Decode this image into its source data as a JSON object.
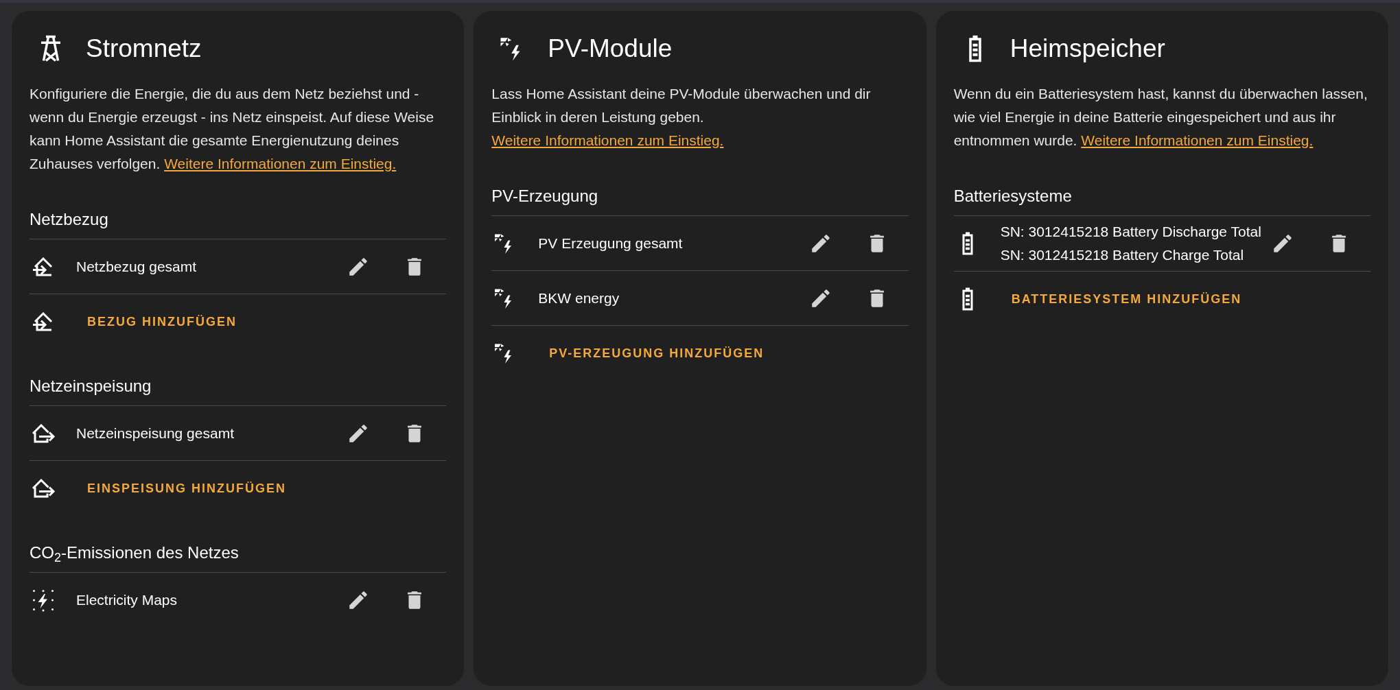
{
  "cards": [
    {
      "title": "Stromnetz",
      "description": "Konfiguriere die Energie, die du aus dem Netz beziehst und - wenn du Energie erzeugst - ins Netz einspeist. Auf diese Weise kann Home Assistant die gesamte Energienutzung deines Zuhauses verfolgen.",
      "link": "Weitere Informationen zum Einstieg.",
      "sections": [
        {
          "heading": "Netzbezug",
          "items": [
            {
              "lines": [
                "Netzbezug gesamt"
              ]
            }
          ],
          "add_label": "BEZUG HINZUFÜGEN"
        },
        {
          "heading": "Netzeinspeisung",
          "items": [
            {
              "lines": [
                "Netzeinspeisung gesamt"
              ]
            }
          ],
          "add_label": "EINSPEISUNG HINZUFÜGEN"
        },
        {
          "heading": "CO$_{2}$-Emissionen des Netzes",
          "items": [
            {
              "lines": [
                "Electricity Maps"
              ]
            }
          ]
        }
      ]
    },
    {
      "title": "PV-Module",
      "description": "Lass Home Assistant deine PV-Module überwachen und dir Einblick in deren Leistung geben.",
      "link": "Weitere Informationen zum Einstieg.",
      "sections": [
        {
          "heading": "PV-Erzeugung",
          "items": [
            {
              "lines": [
                "PV Erzeugung gesamt"
              ]
            },
            {
              "lines": [
                "BKW energy"
              ]
            }
          ],
          "add_label": "PV-ERZEUGUNG HINZUFÜGEN"
        }
      ]
    },
    {
      "title": "Heimspeicher",
      "description": "Wenn du ein Batteriesystem hast, kannst du überwachen lassen, wie viel Energie in deine Batterie eingespeichert und aus ihr entnommen wurde.",
      "link": "Weitere Informationen zum Einstieg.",
      "sections": [
        {
          "heading": "Batteriesysteme",
          "items": [
            {
              "lines": [
                "SN: 3012415218 Battery Discharge Total",
                "SN: 3012415218 Battery Charge Total"
              ]
            }
          ],
          "add_label": "BATTERIESYSTEM HINZUFÜGEN"
        }
      ]
    }
  ]
}
